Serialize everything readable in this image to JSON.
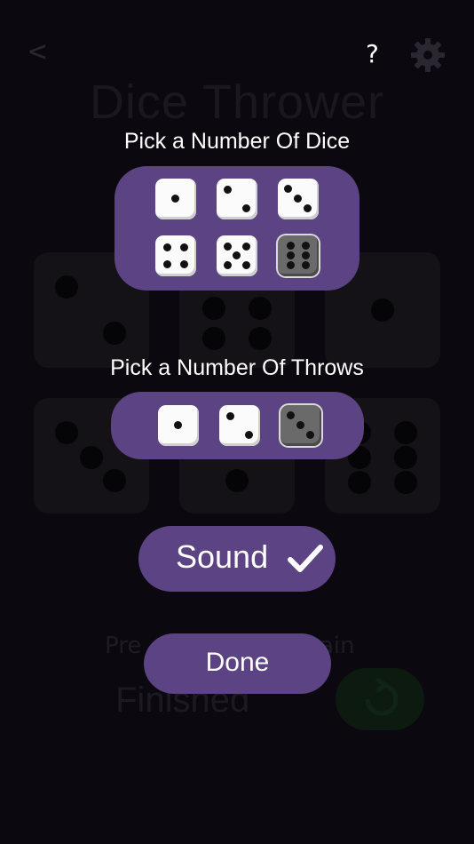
{
  "background": {
    "back_label": "<",
    "title": "Dice Thrower",
    "press_label": "Pre",
    "again_label": "ain",
    "status": "Finished"
  },
  "header": {
    "help_label": "?"
  },
  "dice_picker": {
    "heading": "Pick a Number Of Dice",
    "options": [
      1,
      2,
      3,
      4,
      5,
      6
    ],
    "selected": 6
  },
  "throws_picker": {
    "heading": "Pick a Number Of Throws",
    "options": [
      1,
      2,
      3
    ],
    "selected": 3
  },
  "sound": {
    "label": "Sound",
    "enabled": true
  },
  "done": {
    "label": "Done"
  },
  "colors": {
    "accent": "#5c4383",
    "background": "#0b0810"
  },
  "icons": {
    "settings": "gear-icon",
    "sound_state": "check-icon",
    "back": "chevron-left-icon",
    "replay": "refresh-icon"
  }
}
